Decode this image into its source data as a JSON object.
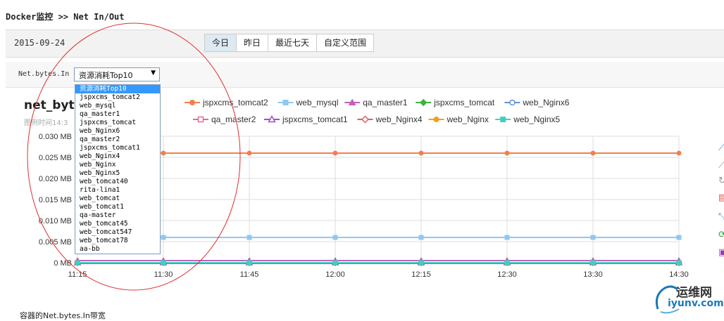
{
  "header": {
    "breadcrumb": "Docker监控 >> Net In/Out"
  },
  "date_bar": {
    "date": "2015-09-24",
    "ranges": [
      {
        "label": "今日",
        "active": true
      },
      {
        "label": "昨日",
        "active": false
      },
      {
        "label": "最近七天",
        "active": false
      },
      {
        "label": "自定义范围",
        "active": false
      }
    ]
  },
  "filter": {
    "metric_label": "Net.bytes.In",
    "selected": "资源消耗Top10",
    "options": [
      "资源消耗Top10",
      "jspxcms_tomcat2",
      "web_mysql",
      "qa_master1",
      "jspxcms_tomcat",
      "web_Nginx6",
      "qa_master2",
      "jspxcms_tomcat1",
      "web_Nginx4",
      "web_Nginx",
      "web_Nginx5",
      "web_tomcat40",
      "rita-lina1",
      "web_tomcat",
      "web_tomcat1",
      "qa-master",
      "web_tomcat45",
      "web_tomcat547",
      "web_tomcat78",
      "aa-bb"
    ]
  },
  "chart": {
    "title": "net_byte",
    "subtitle": "图例时间14:3"
  },
  "footer": {
    "text": "容器的Net.bytes.In带宽"
  },
  "watermark": {
    "top": "运维网",
    "bottom": "iyunv.com"
  },
  "colors": {
    "accent": "#3399ff",
    "annotation": "#e03030"
  },
  "chart_data": {
    "type": "line",
    "x": [
      "11:15",
      "11:30",
      "11:45",
      "12:00",
      "12:15",
      "12:30",
      "13:30",
      "14:30"
    ],
    "yticks": [
      "0 MB",
      "0.005 MB",
      "0.010 MB",
      "0.015 MB",
      "0.020 MB",
      "0.025 MB",
      "0.030 MB"
    ],
    "ylim": [
      0,
      0.03
    ],
    "grid": true,
    "legend_position": "top",
    "series": [
      {
        "name": "jspxcms_tomcat2",
        "color": "#f08050",
        "marker": "circle",
        "values": [
          0.026,
          0.026,
          0.026,
          0.026,
          0.026,
          0.026,
          0.026,
          0.026
        ]
      },
      {
        "name": "web_mysql",
        "color": "#8fc8f0",
        "marker": "square",
        "values": [
          0.006,
          0.006,
          0.006,
          0.006,
          0.006,
          0.006,
          0.006,
          0.006
        ]
      },
      {
        "name": "qa_master1",
        "color": "#c060c0",
        "marker": "triangle",
        "values": [
          0.0005,
          0.0005,
          0.0005,
          0.0005,
          0.0005,
          0.0005,
          0.0005,
          0.0005
        ]
      },
      {
        "name": "jspxcms_tomcat",
        "color": "#40b040",
        "marker": "diamond",
        "values": [
          0,
          0,
          0,
          0,
          0,
          0,
          0,
          0
        ]
      },
      {
        "name": "web_Nginx6",
        "color": "#6090d0",
        "marker": "circle-open",
        "values": [
          0,
          0,
          0,
          0,
          0,
          0,
          0,
          0
        ]
      },
      {
        "name": "qa_master2",
        "color": "#e07090",
        "marker": "square-open",
        "values": [
          0,
          0,
          0,
          0,
          0,
          0,
          0,
          0
        ]
      },
      {
        "name": "jspxcms_tomcat1",
        "color": "#a050c0",
        "marker": "triangle-open",
        "values": [
          0,
          0,
          0,
          0,
          0,
          0,
          0,
          0
        ]
      },
      {
        "name": "web_Nginx4",
        "color": "#e06060",
        "marker": "diamond-open",
        "values": [
          0,
          0,
          0,
          0,
          0,
          0,
          0,
          0
        ]
      },
      {
        "name": "web_Nginx",
        "color": "#f0a020",
        "marker": "circle",
        "values": [
          0,
          0,
          0,
          0,
          0,
          0,
          0,
          0
        ]
      },
      {
        "name": "web_Nginx5",
        "color": "#40d0c0",
        "marker": "square",
        "values": [
          0,
          0,
          0,
          0,
          0,
          0,
          0,
          0
        ]
      }
    ]
  }
}
